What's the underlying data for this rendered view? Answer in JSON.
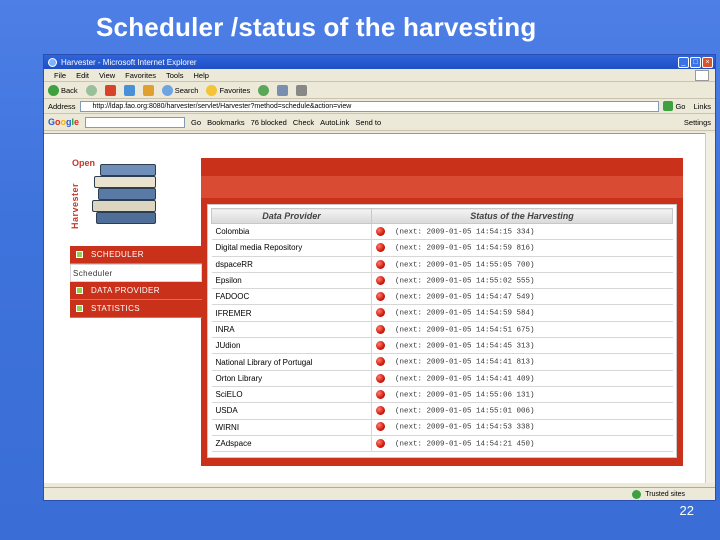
{
  "slide": {
    "title": "Scheduler /status of the harvesting",
    "number": "22"
  },
  "browser": {
    "title": "Harvester - Microsoft Internet Explorer",
    "menu": [
      "File",
      "Edit",
      "View",
      "Favorites",
      "Tools",
      "Help"
    ],
    "toolbar": {
      "back": "Back",
      "search": "Search",
      "favorites": "Favorites"
    },
    "address_label": "Address",
    "address_value": "http://ldap.fao.org:8080/harvester/servlet/Harvester?method=schedule&action=view",
    "go_label": "Go",
    "links_label": "Links",
    "google": {
      "logo": [
        "G",
        "o",
        "o",
        "g",
        "l",
        "e"
      ],
      "go": "Go",
      "bookmarks": "Bookmarks",
      "blocked": "76 blocked",
      "check": "Check",
      "autolink": "AutoLink",
      "send_to": "Send to",
      "settings": "Settings"
    },
    "status_zone": "Trusted sites"
  },
  "app": {
    "logo_top": "Open",
    "logo_side": "Harvester",
    "sidebar": {
      "scheduler": "SCHEDULER",
      "current": "Scheduler",
      "data_provider": "DATA PROVIDER",
      "statistics": "STATISTICS"
    },
    "table": {
      "headers": [
        "Data Provider",
        "Status of the Harvesting"
      ],
      "rows": [
        {
          "provider": "Colombia",
          "status": "(next: 2009-01-05 14:54:15 334)"
        },
        {
          "provider": "Digital media Repository",
          "status": "(next: 2009-01-05 14:54:59 816)"
        },
        {
          "provider": "dspaceRR",
          "status": "(next: 2009-01-05 14:55:05 700)"
        },
        {
          "provider": "Epsilon",
          "status": "(next: 2009-01-05 14:55:02 555)"
        },
        {
          "provider": "FADOOC",
          "status": "(next: 2009-01-05 14:54:47 549)"
        },
        {
          "provider": "IFREMER",
          "status": "(next: 2009-01-05 14:54:59 584)"
        },
        {
          "provider": "INRA",
          "status": "(next: 2009-01-05 14:54:51 675)"
        },
        {
          "provider": "JUdion",
          "status": "(next: 2009-01-05 14:54:45 313)"
        },
        {
          "provider": "National Library of Portugal",
          "status": "(next: 2009-01-05 14:54:41 813)"
        },
        {
          "provider": "Orton Library",
          "status": "(next: 2009-01-05 14:54:41 409)"
        },
        {
          "provider": "SciELO",
          "status": "(next: 2009-01-05 14:55:06 131)"
        },
        {
          "provider": "USDA",
          "status": "(next: 2009-01-05 14:55:01 006)"
        },
        {
          "provider": "WIRNI",
          "status": "(next: 2009-01-05 14:54:53 338)"
        },
        {
          "provider": "ZAdspace",
          "status": "(next: 2009-01-05 14:54:21 450)"
        }
      ]
    }
  },
  "colors": {
    "accent": "#c9311b",
    "slide_bg": "#4277df",
    "status_dot": "#d0190d"
  }
}
